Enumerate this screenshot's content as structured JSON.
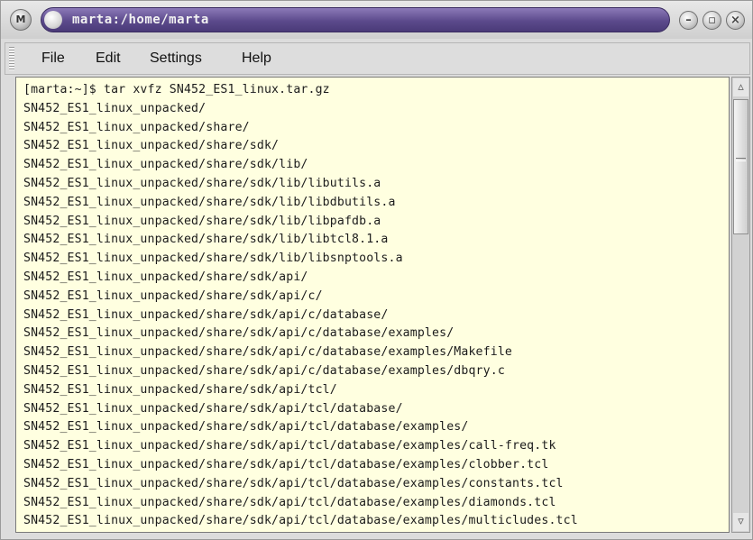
{
  "window": {
    "title": "marta:/home/marta",
    "menu_button_icon": "M"
  },
  "menubar": {
    "items": [
      "File",
      "Edit",
      "Settings",
      "Help"
    ]
  },
  "terminal": {
    "background": "#ffffe0",
    "lines": [
      "[marta:~]$ tar xvfz SN452_ES1_linux.tar.gz",
      "SN452_ES1_linux_unpacked/",
      "SN452_ES1_linux_unpacked/share/",
      "SN452_ES1_linux_unpacked/share/sdk/",
      "SN452_ES1_linux_unpacked/share/sdk/lib/",
      "SN452_ES1_linux_unpacked/share/sdk/lib/libutils.a",
      "SN452_ES1_linux_unpacked/share/sdk/lib/libdbutils.a",
      "SN452_ES1_linux_unpacked/share/sdk/lib/libpafdb.a",
      "SN452_ES1_linux_unpacked/share/sdk/lib/libtcl8.1.a",
      "SN452_ES1_linux_unpacked/share/sdk/lib/libsnptools.a",
      "SN452_ES1_linux_unpacked/share/sdk/api/",
      "SN452_ES1_linux_unpacked/share/sdk/api/c/",
      "SN452_ES1_linux_unpacked/share/sdk/api/c/database/",
      "SN452_ES1_linux_unpacked/share/sdk/api/c/database/examples/",
      "SN452_ES1_linux_unpacked/share/sdk/api/c/database/examples/Makefile",
      "SN452_ES1_linux_unpacked/share/sdk/api/c/database/examples/dbqry.c",
      "SN452_ES1_linux_unpacked/share/sdk/api/tcl/",
      "SN452_ES1_linux_unpacked/share/sdk/api/tcl/database/",
      "SN452_ES1_linux_unpacked/share/sdk/api/tcl/database/examples/",
      "SN452_ES1_linux_unpacked/share/sdk/api/tcl/database/examples/call-freq.tk",
      "SN452_ES1_linux_unpacked/share/sdk/api/tcl/database/examples/clobber.tcl",
      "SN452_ES1_linux_unpacked/share/sdk/api/tcl/database/examples/constants.tcl",
      "SN452_ES1_linux_unpacked/share/sdk/api/tcl/database/examples/diamonds.tcl",
      "SN452_ES1_linux_unpacked/share/sdk/api/tcl/database/examples/multicludes.tcl"
    ]
  },
  "colors": {
    "title_pill": "#5c4a8c",
    "terminal_bg": "#ffffe0",
    "chrome": "#dcdcdc"
  }
}
